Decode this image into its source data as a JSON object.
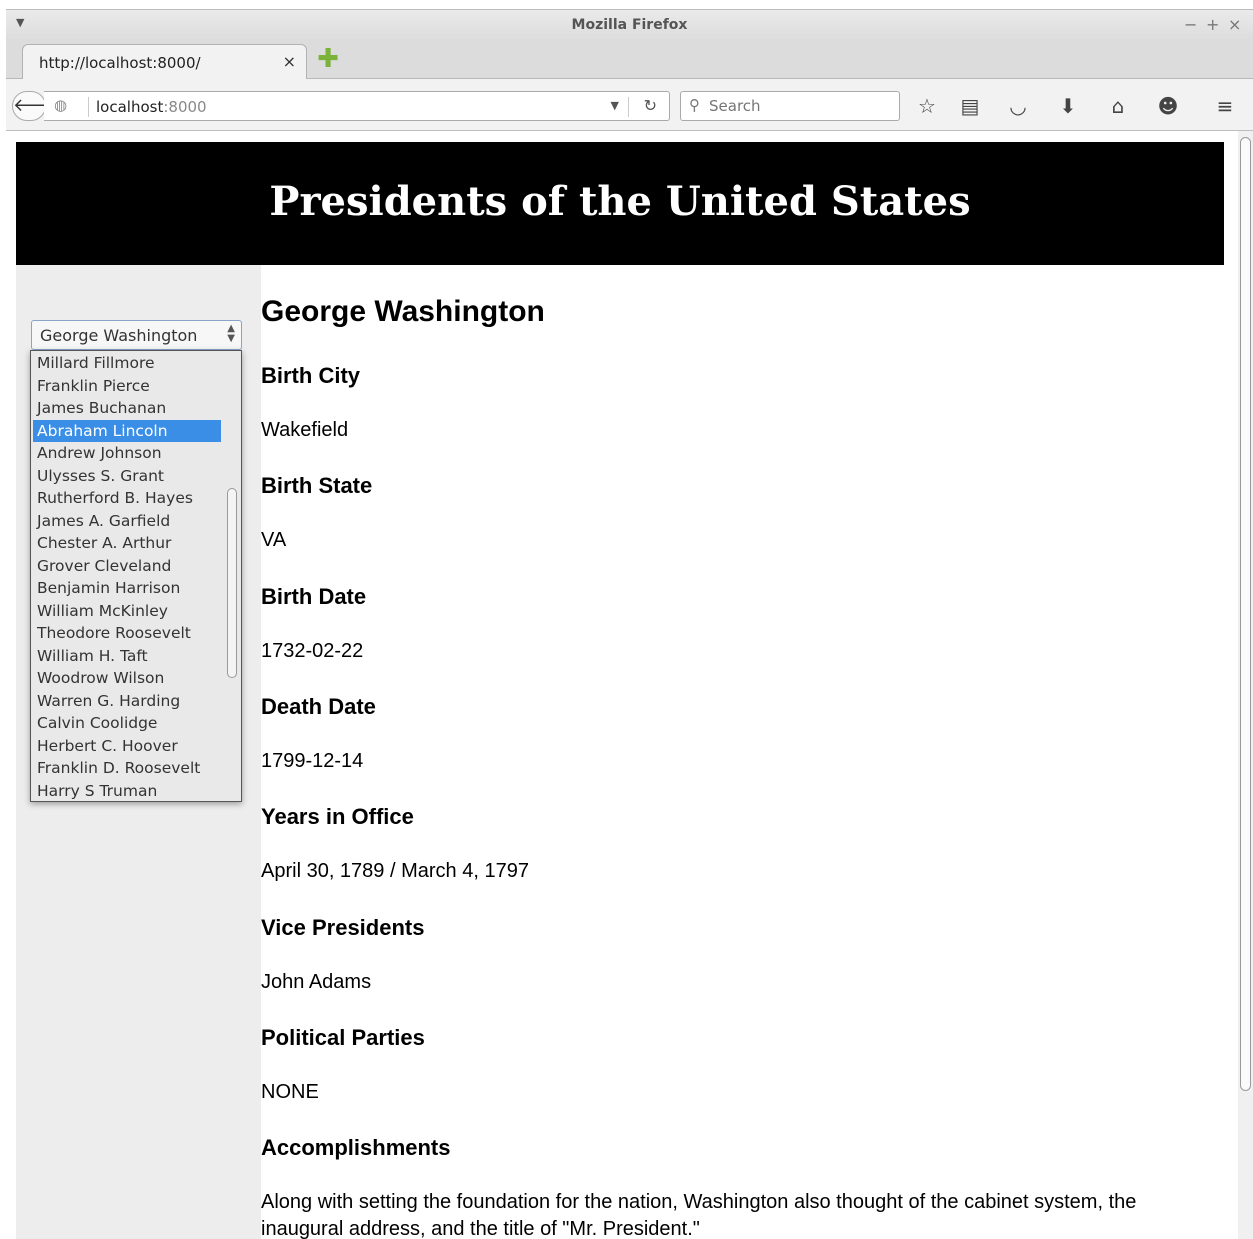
{
  "browser": {
    "window_title": "Mozilla Firefox",
    "window_controls": [
      "−",
      "+",
      "×"
    ],
    "tab_title": "http://localhost:8000/",
    "tab_close": "×",
    "url_host": "localhost",
    "url_port": ":8000",
    "search_placeholder": "Search",
    "toolbar_icons": [
      "star-icon",
      "reading-list-icon",
      "pocket-icon",
      "download-icon",
      "home-icon",
      "chat-icon",
      "menu-icon"
    ]
  },
  "page": {
    "header_title": "Presidents of the United States",
    "select_value": "George Washington",
    "dropdown_options": [
      "Millard Fillmore",
      "Franklin Pierce",
      "James Buchanan",
      "Abraham Lincoln",
      "Andrew Johnson",
      "Ulysses S. Grant",
      "Rutherford B. Hayes",
      "James A. Garfield",
      "Chester A. Arthur",
      "Grover Cleveland",
      "Benjamin Harrison",
      "William McKinley",
      "Theodore Roosevelt",
      "William H. Taft",
      "Woodrow Wilson",
      "Warren G. Harding",
      "Calvin Coolidge",
      "Herbert C. Hoover",
      "Franklin D. Roosevelt",
      "Harry S Truman"
    ],
    "highlighted_option": "Abraham Lincoln",
    "president_name": "George Washington",
    "fields": [
      {
        "label": "Birth City",
        "value": "Wakefield"
      },
      {
        "label": "Birth State",
        "value": "VA"
      },
      {
        "label": "Birth Date",
        "value": "1732-02-22"
      },
      {
        "label": "Death Date",
        "value": "1799-12-14"
      },
      {
        "label": "Years in Office",
        "value": "April 30, 1789 / March 4, 1797"
      },
      {
        "label": "Vice Presidents",
        "value": "John Adams"
      },
      {
        "label": "Political Parties",
        "value": "NONE"
      },
      {
        "label": "Accomplishments",
        "value": "Along with setting the foundation for the nation, Washington also thought of the cabinet system, the inaugural address, and the title of \"Mr. President.\""
      }
    ]
  },
  "colors": {
    "header_bg": "#000000",
    "header_text": "#ffffff",
    "sidebar_bg": "#ededed",
    "highlight": "#3a8ee6"
  }
}
